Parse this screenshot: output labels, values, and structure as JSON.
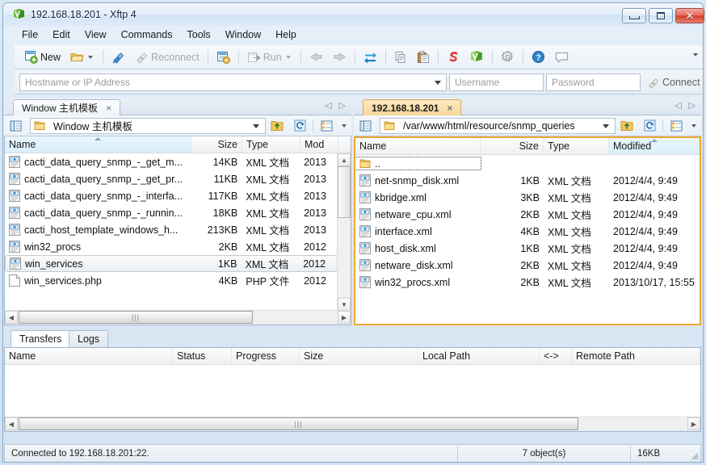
{
  "window": {
    "title": "192.168.18.201 - Xftp 4",
    "icon": "xftp-app-icon",
    "minimize_label": "Minimize",
    "maximize_label": "Maximize",
    "close_label": "Close"
  },
  "menubar": {
    "items": [
      "File",
      "Edit",
      "View",
      "Commands",
      "Tools",
      "Window",
      "Help"
    ]
  },
  "toolbar": {
    "new_label": "New",
    "open_label": "open-folder",
    "connect_icon": "connect-plug-icon",
    "reconnect_label": "Reconnect",
    "transfer_icon": "transfer-window-icon",
    "run_label": "Run",
    "back_icon": "back-arrow-icon",
    "forward_icon": "forward-arrow-icon",
    "sync_icon": "sync-browse-icon",
    "copy_icon": "copy-icon",
    "paste_icon": "paste-icon",
    "xshell_icon": "xshell-icon",
    "xftp_icon": "xftp-icon",
    "settings_icon": "gear-icon",
    "help_icon": "help-icon",
    "chat_icon": "chat-icon",
    "overflow_icon": "toolbar-overflow-icon"
  },
  "connection_bar": {
    "host_placeholder": "Hostname or IP Address",
    "host_value": "",
    "username_placeholder": "Username",
    "username_value": "",
    "password_placeholder": "Password",
    "password_value": "",
    "connect_label": "Connect"
  },
  "left_pane": {
    "tab": {
      "label": "Window 主机模板",
      "active": false,
      "close": "×"
    },
    "nav_prev": "◁",
    "nav_next": "▷",
    "path": {
      "value": "Window 主机模板",
      "icon": "folder-icon"
    },
    "path_buttons": {
      "tree_toggle": "folder-tree-icon",
      "up": "up-one-level-icon",
      "refresh": "refresh-icon",
      "view": "view-mode-icon"
    },
    "columns": [
      {
        "label": "Name",
        "sorted": true,
        "align": "left"
      },
      {
        "label": "Size",
        "sorted": false,
        "align": "right"
      },
      {
        "label": "Type",
        "sorted": false,
        "align": "left"
      },
      {
        "label": "Mod",
        "sorted": false,
        "align": "left"
      }
    ],
    "rows": [
      {
        "name": "cacti_data_query_snmp_-_get_m...",
        "size": "14KB",
        "type": "XML 文档",
        "modified": "2013",
        "icon": "xml-file-icon",
        "selected": false
      },
      {
        "name": "cacti_data_query_snmp_-_get_pr...",
        "size": "11KB",
        "type": "XML 文档",
        "modified": "2013",
        "icon": "xml-file-icon",
        "selected": false
      },
      {
        "name": "cacti_data_query_snmp_-_interfa...",
        "size": "117KB",
        "type": "XML 文档",
        "modified": "2013",
        "icon": "xml-file-icon",
        "selected": false
      },
      {
        "name": "cacti_data_query_snmp_-_runnin...",
        "size": "18KB",
        "type": "XML 文档",
        "modified": "2013",
        "icon": "xml-file-icon",
        "selected": false
      },
      {
        "name": "cacti_host_template_windows_h...",
        "size": "213KB",
        "type": "XML 文档",
        "modified": "2013",
        "icon": "xml-file-icon",
        "selected": false
      },
      {
        "name": "win32_procs",
        "size": "2KB",
        "type": "XML 文档",
        "modified": "2012",
        "icon": "xml-file-icon",
        "selected": false
      },
      {
        "name": "win_services",
        "size": "1KB",
        "type": "XML 文档",
        "modified": "2012",
        "icon": "xml-file-icon",
        "selected": true
      },
      {
        "name": "win_services.php",
        "size": "4KB",
        "type": "PHP 文件",
        "modified": "2012",
        "icon": "php-file-icon",
        "selected": false
      }
    ]
  },
  "right_pane": {
    "tab": {
      "label": "192.168.18.201",
      "active": true,
      "close": "×"
    },
    "nav_prev": "◁",
    "nav_next": "▷",
    "path": {
      "value": "/var/www/html/resource/snmp_queries",
      "icon": "folder-icon"
    },
    "path_buttons": {
      "tree_toggle": "folder-tree-icon",
      "up": "up-one-level-icon",
      "refresh": "refresh-icon",
      "view": "view-mode-icon"
    },
    "columns": [
      {
        "label": "Name",
        "sorted": false,
        "align": "left"
      },
      {
        "label": "Size",
        "sorted": false,
        "align": "right"
      },
      {
        "label": "Type",
        "sorted": false,
        "align": "left"
      },
      {
        "label": "Modified",
        "sorted": true,
        "align": "left"
      }
    ],
    "rows": [
      {
        "name": "..",
        "size": "",
        "type": "",
        "modified": "",
        "icon": "folder-up-icon",
        "focused": true
      },
      {
        "name": "net-snmp_disk.xml",
        "size": "1KB",
        "type": "XML 文档",
        "modified": "2012/4/4, 9:49",
        "icon": "xml-file-icon"
      },
      {
        "name": "kbridge.xml",
        "size": "3KB",
        "type": "XML 文档",
        "modified": "2012/4/4, 9:49",
        "icon": "xml-file-icon"
      },
      {
        "name": "netware_cpu.xml",
        "size": "2KB",
        "type": "XML 文档",
        "modified": "2012/4/4, 9:49",
        "icon": "xml-file-icon"
      },
      {
        "name": "interface.xml",
        "size": "4KB",
        "type": "XML 文档",
        "modified": "2012/4/4, 9:49",
        "icon": "xml-file-icon"
      },
      {
        "name": "host_disk.xml",
        "size": "1KB",
        "type": "XML 文档",
        "modified": "2012/4/4, 9:49",
        "icon": "xml-file-icon"
      },
      {
        "name": "netware_disk.xml",
        "size": "2KB",
        "type": "XML 文档",
        "modified": "2012/4/4, 9:49",
        "icon": "xml-file-icon"
      },
      {
        "name": "win32_procs.xml",
        "size": "2KB",
        "type": "XML 文档",
        "modified": "2013/10/17, 15:55",
        "icon": "xml-file-icon"
      }
    ]
  },
  "transfer_panel": {
    "tabs": [
      {
        "label": "Transfers",
        "active": true
      },
      {
        "label": "Logs",
        "active": false
      }
    ],
    "columns": [
      "Name",
      "Status",
      "Progress",
      "Size",
      "Local Path",
      "<->",
      "Remote Path"
    ],
    "rows": []
  },
  "statusbar": {
    "message": "Connected to 192.168.18.201:22.",
    "object_count": "7 object(s)",
    "total_size": "16KB",
    "resize_grip": "resize-grip-icon"
  },
  "colors": {
    "active_tab": "#f8d79a",
    "active_pane_border": "#f0a832",
    "sorted_column": "#d9eefa",
    "frame": "#8ea9c4"
  }
}
